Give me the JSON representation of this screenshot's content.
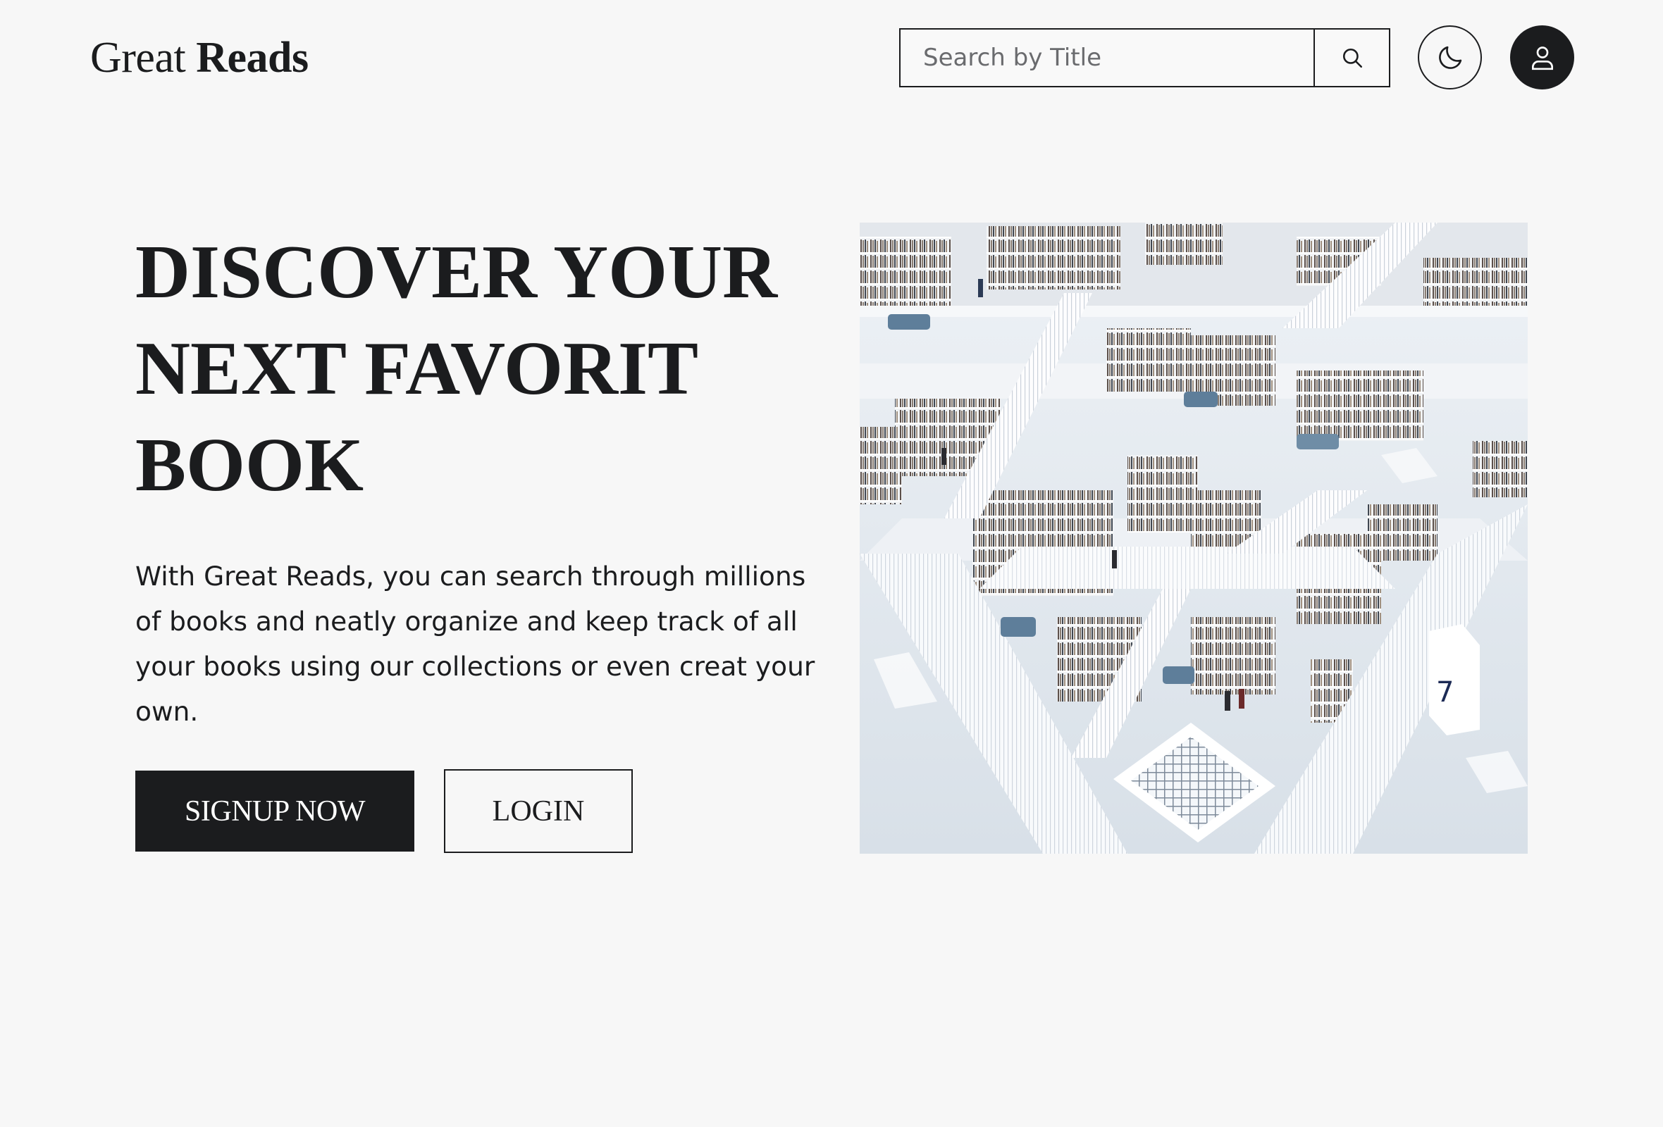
{
  "brand": {
    "name_light": "Great",
    "name_bold": "Reads"
  },
  "search": {
    "placeholder": "Search by Title",
    "value": "",
    "button_icon": "search-icon"
  },
  "header_actions": {
    "theme_icon": "moon-icon",
    "profile_icon": "user-icon"
  },
  "hero": {
    "title_lines": [
      "DISCOVER YOUR",
      "NEXT FAVORIT",
      "BOOK"
    ],
    "description_lines": [
      "With Great Reads, you can search through millions",
      "of books and neatly organize and keep track of all",
      "your books using our collections or even creat your",
      "own."
    ],
    "signup_label": "SIGNUP NOW",
    "login_label": "LOGIN",
    "image_sign_number": "7"
  },
  "colors": {
    "background": "#f7f7f7",
    "primary_dark": "#1b1c1e",
    "text_light": "#ffffff",
    "placeholder": "#6a6b6e"
  }
}
